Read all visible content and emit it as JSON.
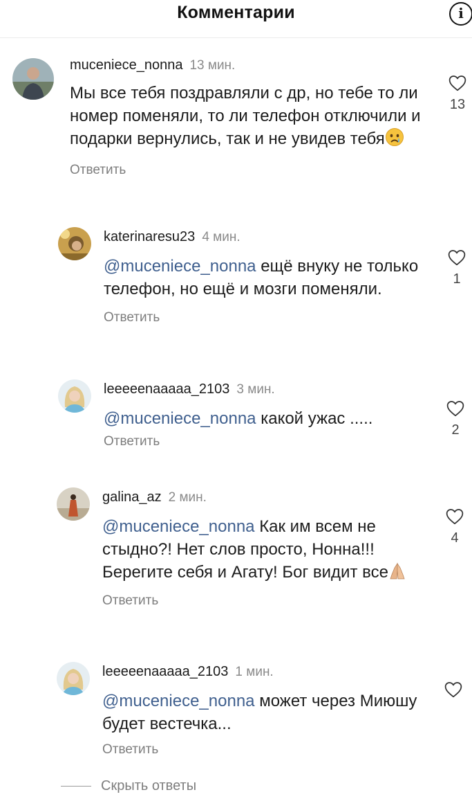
{
  "header": {
    "title": "Комментарии",
    "info_icon": "info-circle-icon"
  },
  "comments": [
    {
      "username": "muceniece_nonna",
      "time": "13 мин.",
      "mention": "",
      "text": "Мы все тебя поздравляли с др, но тебе то ли номер поменяли, то ли телефон отключили и подарки вернулись, так и не увидев тебя",
      "emoji": "crying-face-emoji",
      "reply_label": "Ответить",
      "likes": "13"
    },
    {
      "username": "katerinaresu23",
      "time": "4 мин.",
      "mention": "@muceniece_nonna",
      "text": "ещё внуку не только телефон, но ещё и мозги поменяли.",
      "reply_label": "Ответить",
      "likes": "1"
    },
    {
      "username": "leeeeenaaaaa_2103",
      "time": "3 мин.",
      "mention": "@muceniece_nonna",
      "text": "какой ужас .....",
      "reply_label": "Ответить",
      "likes": "2"
    },
    {
      "username": "galina_az",
      "time": "2 мин.",
      "mention": "@muceniece_nonna",
      "text": "Как им всем не стыдно?! Нет слов просто, Нонна!!! Берегите себя и Агату! Бог видит все",
      "emoji": "praying-hands-emoji",
      "reply_label": "Ответить",
      "likes": "4"
    },
    {
      "username": "leeeeenaaaaa_2103",
      "time": "1 мин.",
      "mention": "@muceniece_nonna",
      "text": "может через Миюшу будет вестечка...",
      "reply_label": "Ответить",
      "likes": ""
    }
  ],
  "hide_replies_label": "Скрыть ответы",
  "colors": {
    "mention": "#3f5f8e",
    "muted_text": "#7d7d7d",
    "primary_text": "#1c1c1c"
  }
}
